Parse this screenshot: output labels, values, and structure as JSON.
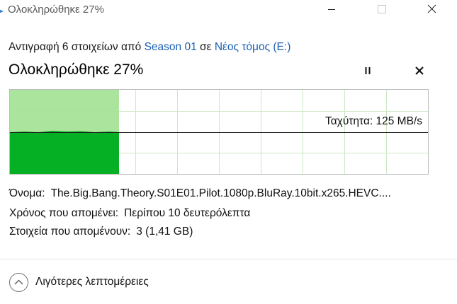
{
  "window": {
    "title": "Ολοκληρώθηκε 27%",
    "buttons": {
      "minimize": "minimize-icon",
      "maximize": "maximize-icon",
      "close": "close-icon"
    }
  },
  "header": {
    "prefix": "Αντιγραφή 6 στοιχείων από",
    "source": "Season 01",
    "connector": "σε",
    "destination": "Νέος τόμος (E:)"
  },
  "progress": {
    "heading": "Ολοκληρώθηκε 27%",
    "percent": 27,
    "speed_label": "Ταχύτητα: 125 MB/s"
  },
  "details": {
    "name_label": "Όνομα:",
    "name_value": "The.Big.Bang.Theory.S01E01.Pilot.1080p.BluRay.10bit.x265.HEVC....",
    "time_label": "Χρόνος που απομένει:",
    "time_value": "Περίπου 10 δευτερόλεπτα",
    "items_label": "Στοιχεία που απομένουν:",
    "items_value": "3 (1,41 GB)"
  },
  "footer": {
    "toggle_label": "Λιγότερες λεπτομέρειες"
  },
  "colors": {
    "progress_fill": "#06b025",
    "progress_light": "#a6e397",
    "grid": "#cde8c4",
    "link": "#1a5fb4"
  }
}
